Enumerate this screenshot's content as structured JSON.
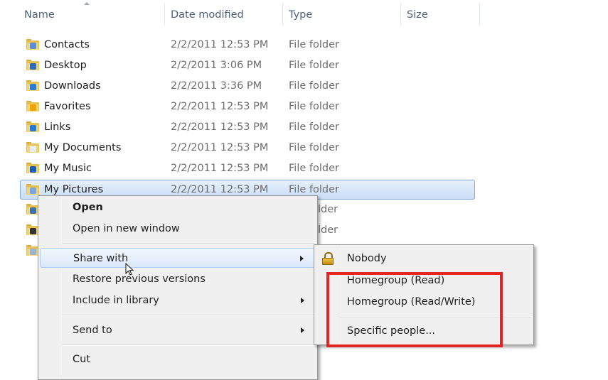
{
  "columns": {
    "name": "Name",
    "date_modified": "Date modified",
    "type": "Type",
    "size": "Size"
  },
  "files": [
    {
      "name": "Contacts",
      "date": "2/2/2011 12:53 PM",
      "type": "File folder",
      "icon": "contacts-folder-icon",
      "badge": "#5b8fd0"
    },
    {
      "name": "Desktop",
      "date": "2/2/2011 3:06 PM",
      "type": "File folder",
      "icon": "desktop-folder-icon",
      "badge": "#2f6bb7"
    },
    {
      "name": "Downloads",
      "date": "2/2/2011 3:36 PM",
      "type": "File folder",
      "icon": "downloads-folder-icon",
      "badge": "#2b7bd4"
    },
    {
      "name": "Favorites",
      "date": "2/2/2011 12:53 PM",
      "type": "File folder",
      "icon": "favorites-folder-icon",
      "badge": "#f0a30a"
    },
    {
      "name": "Links",
      "date": "2/2/2011 12:53 PM",
      "type": "File folder",
      "icon": "links-folder-icon",
      "badge": "#2a7bd0"
    },
    {
      "name": "My Documents",
      "date": "2/2/2011 12:53 PM",
      "type": "File folder",
      "icon": "documents-folder-icon",
      "badge": "#e9eef5"
    },
    {
      "name": "My Music",
      "date": "2/2/2011 12:53 PM",
      "type": "File folder",
      "icon": "music-folder-icon",
      "badge": "#1c5fb0"
    },
    {
      "name": "My Pictures",
      "date": "2/2/2011 12:53 PM",
      "type": "File folder",
      "icon": "pictures-folder-icon",
      "badge": "#7aa7d8"
    },
    {
      "name": "",
      "date": "",
      "type": "lder",
      "icon": "videos-folder-icon",
      "badge": "#3d6ea5"
    },
    {
      "name": "",
      "date": "",
      "type": "lder",
      "icon": "games-folder-icon",
      "badge": "#333333"
    },
    {
      "name": "",
      "date": "",
      "type": "",
      "icon": "searches-folder-icon",
      "badge": "#9bb4d3"
    }
  ],
  "context_menu": {
    "open": "Open",
    "open_new_window": "Open in new window",
    "share_with": "Share with",
    "restore_previous": "Restore previous versions",
    "include_in_library": "Include in library",
    "send_to": "Send to",
    "cut": "Cut"
  },
  "share_submenu": {
    "nobody": "Nobody",
    "homegroup_read": "Homegroup (Read)",
    "homegroup_read_write": "Homegroup (Read/Write)",
    "specific_people": "Specific people..."
  },
  "highlight_color": "#e32526"
}
